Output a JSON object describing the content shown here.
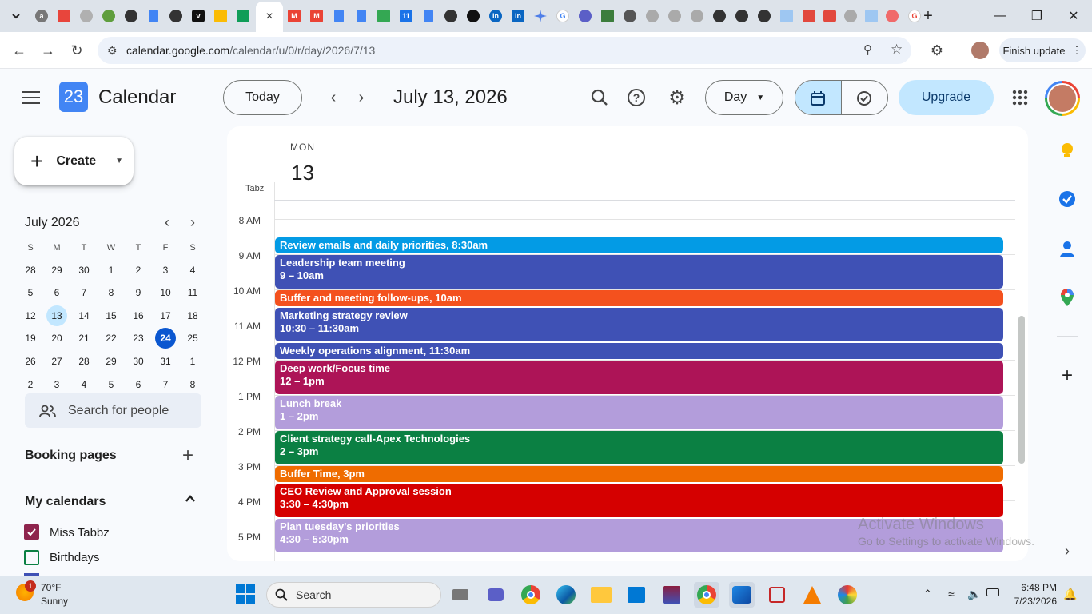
{
  "browser": {
    "url_host": "calendar.google.com",
    "url_path": "/calendar/u/0/r/day/2026/7/13",
    "finish_update_label": "Finish update",
    "active_tab_close": "×",
    "new_tab": "+"
  },
  "header": {
    "app_title": "Calendar",
    "logo_day": "23",
    "today_label": "Today",
    "current_date": "July 13, 2026",
    "view_label": "Day",
    "upgrade_label": "Upgrade"
  },
  "sidebar": {
    "create_label": "Create",
    "mini_month": "July 2026",
    "weekday_headers": [
      "S",
      "M",
      "T",
      "W",
      "T",
      "F",
      "S"
    ],
    "weeks": [
      [
        "28",
        "29",
        "30",
        "1",
        "2",
        "3",
        "4"
      ],
      [
        "5",
        "6",
        "7",
        "8",
        "9",
        "10",
        "11"
      ],
      [
        "12",
        "13",
        "14",
        "15",
        "16",
        "17",
        "18"
      ],
      [
        "19",
        "20",
        "21",
        "22",
        "23",
        "24",
        "25"
      ],
      [
        "26",
        "27",
        "28",
        "29",
        "30",
        "31",
        "1"
      ],
      [
        "2",
        "3",
        "4",
        "5",
        "6",
        "7",
        "8"
      ]
    ],
    "selected_day": "13",
    "today_day": "24",
    "search_people_placeholder": "Search for people",
    "booking_pages_label": "Booking pages",
    "my_calendars_label": "My calendars",
    "calendars": [
      {
        "name": "Miss Tabbz",
        "checked": true,
        "color": "#8e244d"
      },
      {
        "name": "Birthdays",
        "checked": false,
        "color": "#0b8043"
      }
    ]
  },
  "day_view": {
    "weekday": "MON",
    "day_number": "13",
    "timezone_label": "Tabz",
    "hours": [
      "8 AM",
      "9 AM",
      "10 AM",
      "11 AM",
      "12 PM",
      "1 PM",
      "2 PM",
      "3 PM",
      "4 PM",
      "5 PM"
    ],
    "events": [
      {
        "title": "Review emails and daily priorities, 8:30am",
        "time": "",
        "color": "#039be5"
      },
      {
        "title": "Leadership team meeting",
        "time": "9 – 10am",
        "color": "#3f51b5"
      },
      {
        "title": "Buffer and meeting follow-ups, 10am",
        "time": "",
        "color": "#f4511e"
      },
      {
        "title": "Marketing strategy review",
        "time": "10:30 – 11:30am",
        "color": "#3f51b5"
      },
      {
        "title": "Weekly operations alignment, 11:30am",
        "time": "",
        "color": "#3f51b5"
      },
      {
        "title": "Deep work/Focus time",
        "time": "12 – 1pm",
        "color": "#ad1457"
      },
      {
        "title": "Lunch break",
        "time": "1 – 2pm",
        "color": "#b39ddb"
      },
      {
        "title": "Client strategy call-Apex Technologies",
        "time": "2 – 3pm",
        "color": "#0b8043"
      },
      {
        "title": "Buffer Time, 3pm",
        "time": "",
        "color": "#ef6c00"
      },
      {
        "title": "CEO Review and Approval session",
        "time": "3:30 – 4:30pm",
        "color": "#d50000"
      },
      {
        "title": "Plan tuesday's priorities",
        "time": "4:30 – 5:30pm",
        "color": "#b39ddb"
      }
    ]
  },
  "watermark": {
    "line1": "Activate Windows",
    "line2": "Go to Settings to activate Windows."
  },
  "taskbar": {
    "weather_temp": "70°F",
    "weather_desc": "Sunny",
    "weather_badge": "1",
    "search_label": "Search",
    "time": "6:48 PM",
    "date": "7/23/2026"
  },
  "colors": {
    "accent": "#0b57d0",
    "selected_day_bg": "#c2e7ff",
    "upgrade_bg": "#c2e7ff"
  }
}
